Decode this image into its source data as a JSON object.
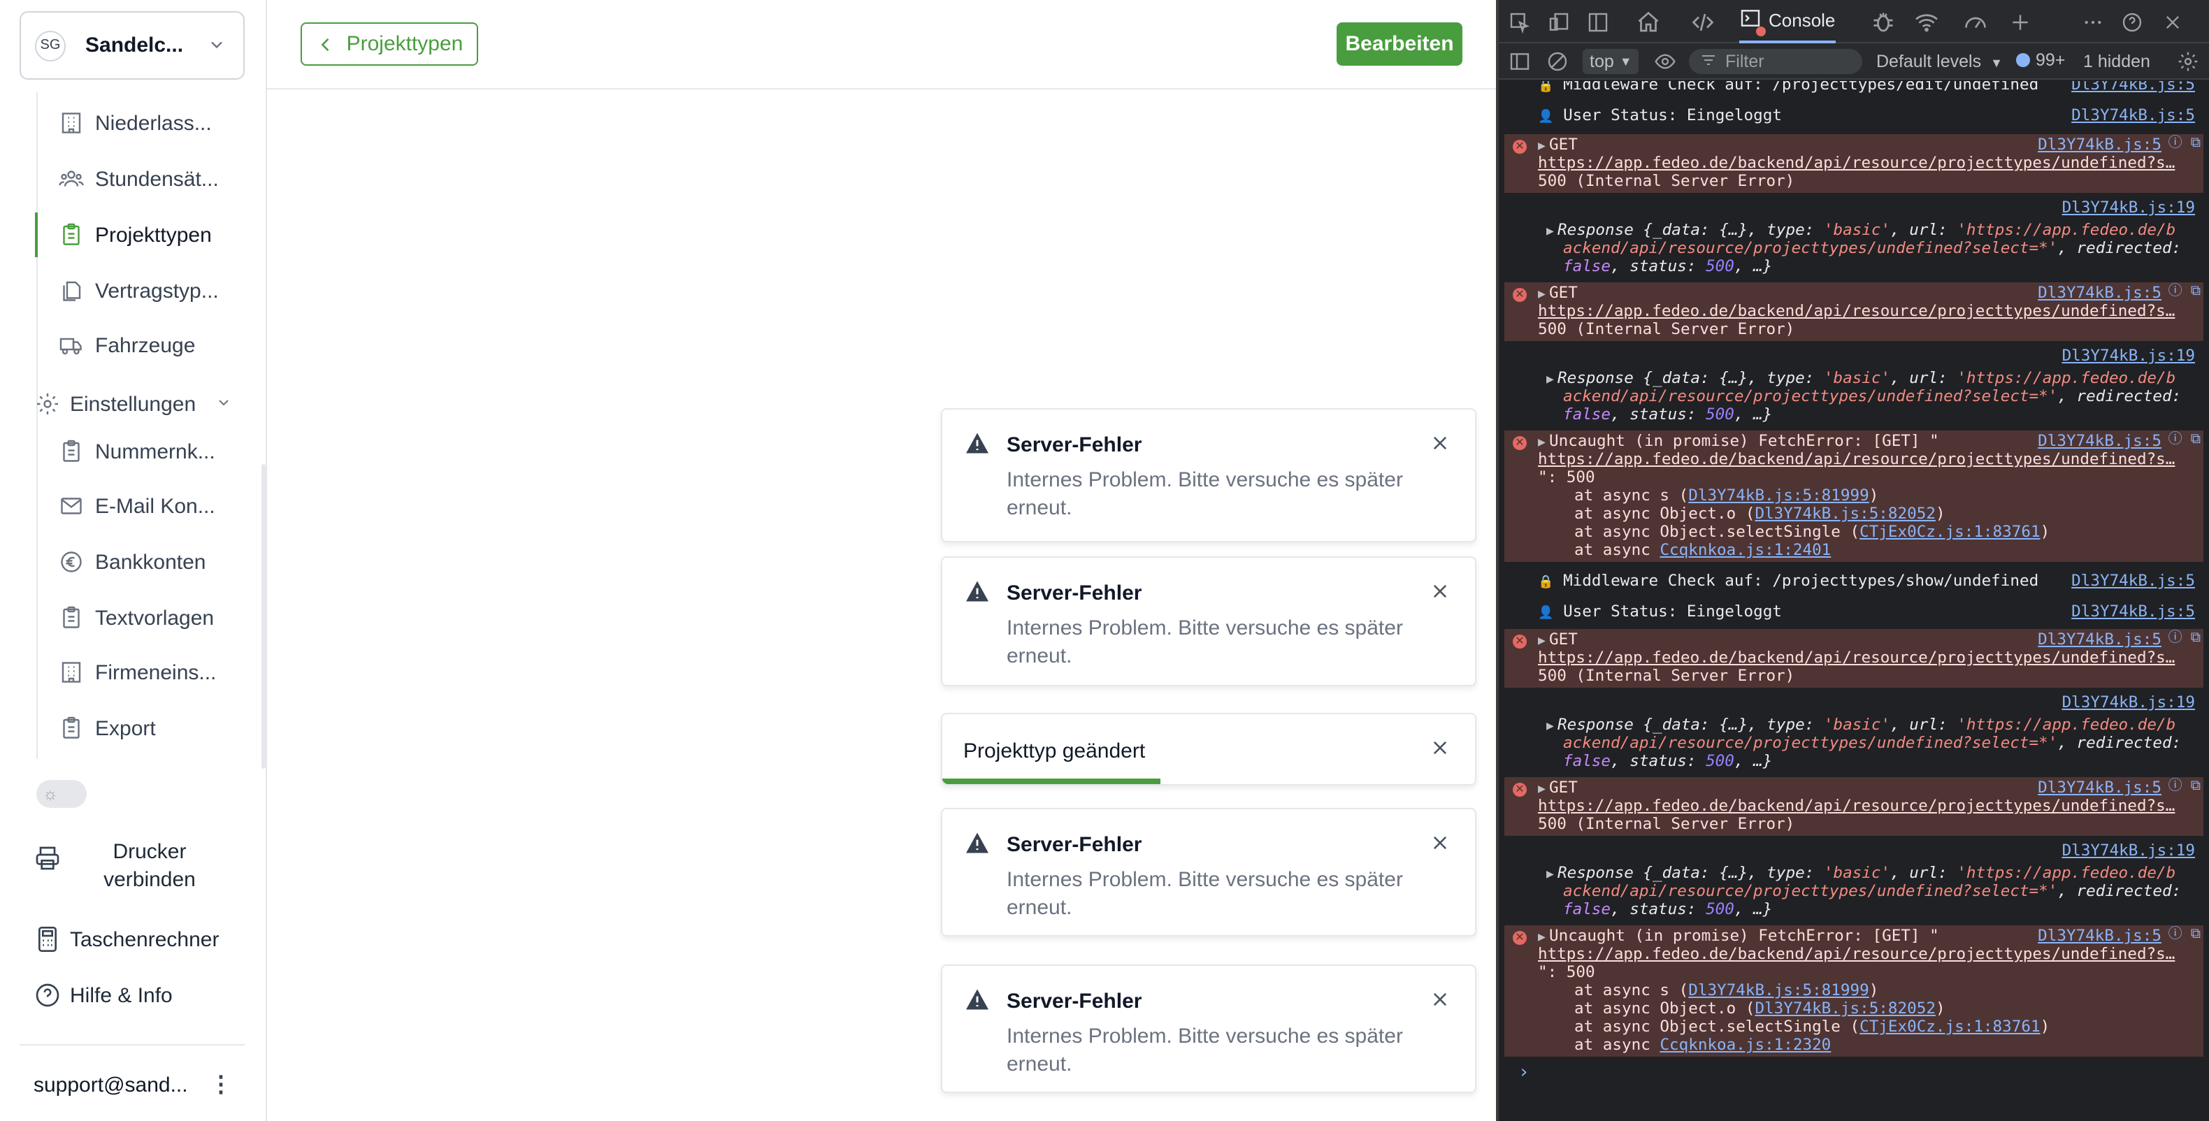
{
  "sidebar": {
    "team": {
      "initials": "SG",
      "name": "Sandelc..."
    },
    "nav_items": [
      {
        "label": "Niederlass...",
        "icon": "building-icon"
      },
      {
        "label": "Stundensät...",
        "icon": "users-icon"
      },
      {
        "label": "Projekttypen",
        "icon": "clipboard-icon",
        "active": true
      },
      {
        "label": "Vertragstyp...",
        "icon": "copy-icon"
      },
      {
        "label": "Fahrzeuge",
        "icon": "truck-icon"
      }
    ],
    "settings_section": {
      "label": "Einstellungen",
      "icon": "gear-icon"
    },
    "settings_items": [
      {
        "label": "Nummernk...",
        "icon": "clipboard-icon"
      },
      {
        "label": "E-Mail Kon...",
        "icon": "mail-icon"
      },
      {
        "label": "Bankkonten",
        "icon": "euro-icon"
      },
      {
        "label": "Textvorlagen",
        "icon": "clipboard-icon"
      },
      {
        "label": "Firmeneins...",
        "icon": "building-icon"
      },
      {
        "label": "Export",
        "icon": "clipboard-icon"
      }
    ],
    "printer": "Drucker verbinden",
    "calculator": "Taschenrechner",
    "help": "Hilfe & Info",
    "user_email": "support@sand...",
    "user_menu": "⋮"
  },
  "main": {
    "back_button": "Projekttypen",
    "edit_button": "Bearbeiten",
    "accent_color": "#4a9d3f"
  },
  "toasts": [
    {
      "title": "Server-Fehler",
      "message": "Internes Problem. Bitte versuche es später erneut."
    },
    {
      "title": "Server-Fehler",
      "message": "Internes Problem. Bitte versuche es später erneut."
    },
    {
      "title": "Projekttyp geändert",
      "progress": 0.41
    },
    {
      "title": "Server-Fehler",
      "message": "Internes Problem. Bitte versuche es später erneut."
    },
    {
      "title": "Server-Fehler",
      "message": "Internes Problem. Bitte versuche es später erneut."
    }
  ],
  "devtools": {
    "active_tab": "Console",
    "context": "top",
    "filter_placeholder": "Filter",
    "levels": "Default levels",
    "issues_count": "99+",
    "hidden": "1 hidden",
    "logs": {
      "mw1": {
        "icon": "🔒",
        "text": "Middleware Check auf: /projecttypes/edit/undefined",
        "src": "Dl3Y74kB.js:5"
      },
      "user1": {
        "icon": "👤",
        "text": "User Status: Eingeloggt",
        "src": "Dl3Y74kB.js:5"
      },
      "get_label": "GET",
      "get_src": "Dl3Y74kB.js:5",
      "get_url": "https://app.fedeo.de/backend/api/resource/projecttypes/undefined?s…",
      "get_status": "500 (Internal Server Error)",
      "resp_src": "Dl3Y74kB.js:19",
      "resp_prefix": "Response {_data: {…}, type: ",
      "resp_type": "'basic'",
      "resp_url_key": ", url: ",
      "resp_url1": "'https://app.fedeo.de/b",
      "resp_url2": "ackend/api/resource/projecttypes/undefined?select=*'",
      "resp_redirected": ", redirected:",
      "resp_false": "false",
      "resp_status_key": ", status: ",
      "resp_status_val": "500",
      "resp_tail": ", …}",
      "uncaught_line1": "Uncaught (in promise) FetchError: [GET] \"",
      "uncaught_src": "Dl3Y74kB.js:5",
      "uncaught_url": "https://app.fedeo.de/backend/api/resource/projecttypes/undefined?s…",
      "uncaught_line3": "\": 500",
      "stack1_prefix": "at async s (",
      "stack1_link": "Dl3Y74kB.js:5:81999",
      "stack2_prefix": "at async Object.o (",
      "stack2_link": "Dl3Y74kB.js:5:82052",
      "stack3_prefix": "at async Object.selectSingle (",
      "stack3_link": "CTjEx0Cz.js:1:83761",
      "stack4_prefix": "at async ",
      "stack4a_link": "Ccqknkoa.js:1:2401",
      "stack4b_link": "Ccqknkoa.js:1:2320",
      "close_paren": ")",
      "mw2": {
        "icon": "🔒",
        "text": "Middleware Check auf: /projecttypes/show/undefined",
        "src": "Dl3Y74kB.js:5"
      },
      "user2": {
        "icon": "👤",
        "text": "User Status: Eingeloggt",
        "src": "Dl3Y74kB.js:5"
      }
    },
    "prompt": "›"
  }
}
